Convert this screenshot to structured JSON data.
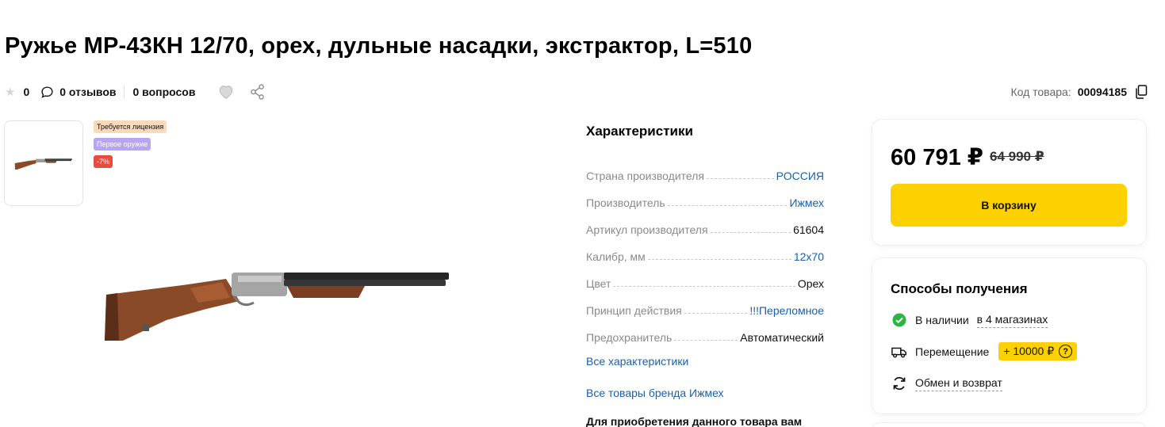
{
  "product": {
    "title": "Ружье МР-43КН 12/70, орех, дульные насадки, экстрактор, L=510",
    "rating": "0",
    "reviews": "0 отзывов",
    "questions": "0 вопросов",
    "code_label": "Код товара:",
    "code_value": "00094185"
  },
  "badges": {
    "license": "Требуется лицензия",
    "first_weapon": "Первое оружие",
    "discount": "-7%"
  },
  "specs": {
    "heading": "Характеристики",
    "rows": [
      {
        "key": "Страна производителя",
        "value": "РОССИЯ"
      },
      {
        "key": "Производитель",
        "value": "Ижмех"
      },
      {
        "key": "Артикул производителя",
        "value": "61604"
      },
      {
        "key": "Калибр, мм",
        "value": "12х70"
      },
      {
        "key": "Цвет",
        "value": "Орех"
      },
      {
        "key": "Принцип действия",
        "value": "!!!Переломное"
      },
      {
        "key": "Предохранитель",
        "value": "Автоматический"
      }
    ],
    "all_link": "Все характеристики",
    "brand_link": "Все товары бренда Ижмех",
    "note": "Для приобретения данного товара вам"
  },
  "price": {
    "current": "60 791 ₽",
    "old": "64 990 ₽",
    "cart_label": "В корзину"
  },
  "delivery": {
    "heading": "Способы получения",
    "in_stock": "В наличии",
    "stores": "в 4 магазинах",
    "transfer": "Перемещение",
    "surcharge": "+ 10000 ₽",
    "surcharge_help": "?",
    "exchange": "Обмен и возврат"
  },
  "colors": {
    "accent": "#fdd000",
    "link": "#1b5fa8",
    "in_stock": "#2fb344",
    "discount": "#e74c3c"
  }
}
